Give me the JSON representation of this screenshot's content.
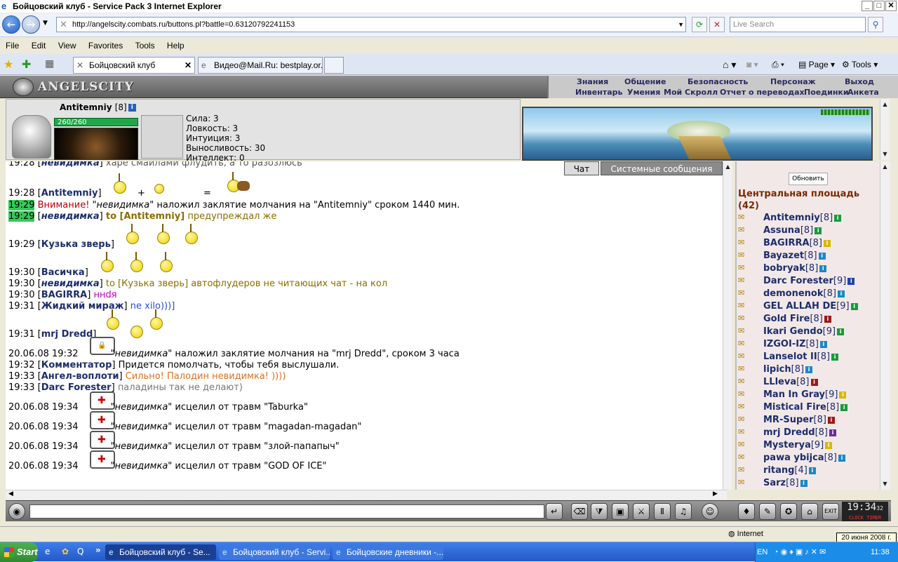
{
  "window": {
    "title": "Бойцовский клуб - Service Pack 3 Internet Explorer"
  },
  "browser": {
    "url": "http://angelscity.combats.ru/buttons.pl?battle=0.63120792241153",
    "search_placeholder": "Live Search",
    "menu": [
      "File",
      "Edit",
      "View",
      "Favorites",
      "Tools",
      "Help"
    ],
    "tabs": [
      "Бойцовский клуб",
      "Видео@Mail.Ru: bestplay.or..."
    ],
    "cmd_page": "Page",
    "cmd_tools": "Tools"
  },
  "game": {
    "logo": "ANGELSCITY",
    "topmenu_row1": [
      "Знания",
      "Общение",
      "Безопасность",
      "Персонаж",
      "Выход"
    ],
    "topmenu_row2": [
      "Инвентарь",
      "Умения",
      "Мой Скролл",
      "Отчет о переводах",
      "Поединки",
      "Анкета"
    ],
    "character": {
      "name": "Antitemniy",
      "level": "[8]",
      "hp": "260/260",
      "stats": [
        "Сила: 3",
        "Ловкость: 3",
        "Интуиция: 3",
        "Выносливость: 30",
        "Интеллект: 0"
      ]
    },
    "chat_tabs": [
      "Чат",
      "Системные сообщения"
    ],
    "chat": [
      {
        "time": "19:28",
        "nick": "невидимка",
        "msg": "харе смайлами флудить, а то разозлюсь"
      },
      {
        "time": "19:28",
        "nick": "Antitemniy",
        "plus": "+",
        "eq": "="
      },
      {
        "time": "19:29",
        "warn": "Внимание!",
        "nick": "невидимка",
        "msg": "наложил заклятие молчания на \"Antitemniy\" сроком 1440 мин."
      },
      {
        "time": "19:29",
        "nick": "невидимка",
        "to": "to [Antitemniy]",
        "msg": "предупреждал же"
      },
      {
        "time": "19:29",
        "nick": "Кузька зверь"
      },
      {
        "time": "19:30",
        "nick": "Васичка"
      },
      {
        "time": "19:30",
        "nick": "невидимка",
        "msg": "to [Кузька зверь] автофлудеров не читающих чат - на кол"
      },
      {
        "time": "19:30",
        "nick": "BAGIRRA",
        "msg": "ннdя"
      },
      {
        "time": "19:31",
        "nick": "Жидкий мираж",
        "msg": "ne xilo)))]"
      },
      {
        "time": "19:31",
        "nick": "mrj Dredd"
      },
      {
        "time": "20.06.08 19:32",
        "nick": "невидимка",
        "msg": "наложил заклятие молчания на \"mrj Dredd\", сроком 3 часа"
      },
      {
        "time": "19:32",
        "nick": "Комментатор",
        "msg": "Придется помолчать, чтобы тебя выслушали."
      },
      {
        "time": "19:33",
        "nick": "Ангел-воплоти",
        "msg": "Сильно! Палодин невидимка! ))))"
      },
      {
        "time": "19:33",
        "nick": "Darc Forester",
        "msg": "паладины так не делают)"
      },
      {
        "time": "20.06.08 19:34",
        "nick": "невидимка",
        "msg": "исцелил от травм \"Taburka\""
      },
      {
        "time": "20.06.08 19:34",
        "nick": "невидимка",
        "msg": "исцелил от травм \"magadan-magadan\""
      },
      {
        "time": "20.06.08 19:34",
        "nick": "невидимка",
        "msg": "исцелил от травм \"злой-папапыч\""
      },
      {
        "time": "20.06.08 19:34",
        "nick": "невидимка",
        "msg": "исцелил от травм \"GOD OF ICE\""
      }
    ],
    "room": {
      "refresh": "Обновить",
      "name": "Центральная площадь",
      "count": "(42)",
      "users": [
        {
          "name": "Antitemniy",
          "lvl": "[8]",
          "badge": "green"
        },
        {
          "name": "Assuna",
          "lvl": "[8]",
          "badge": "green"
        },
        {
          "name": "BAGIRRA",
          "lvl": "[8]",
          "badge": "yellow"
        },
        {
          "name": "Bayazet",
          "lvl": "[8]",
          "badge": "blue"
        },
        {
          "name": "bobryak",
          "lvl": "[8]",
          "badge": "blue"
        },
        {
          "name": "Darc Forester",
          "lvl": "[9]",
          "badge": "darkblue"
        },
        {
          "name": "demonenok",
          "lvl": "[8]",
          "badge": "blue"
        },
        {
          "name": "GEL ALLAH DE",
          "lvl": "[9]",
          "badge": "green"
        },
        {
          "name": "Gold Fire",
          "lvl": "[8]",
          "badge": "red"
        },
        {
          "name": "Ikari Gendo",
          "lvl": "[9]",
          "badge": "green"
        },
        {
          "name": "IZGOI-IZ",
          "lvl": "[8]",
          "badge": "blue"
        },
        {
          "name": "Lanselot II",
          "lvl": "[8]",
          "badge": "green"
        },
        {
          "name": "lipich",
          "lvl": "[8]",
          "badge": "blue"
        },
        {
          "name": "LLleva",
          "lvl": "[8]",
          "badge": "red"
        },
        {
          "name": "Man In Gray",
          "lvl": "[9]",
          "badge": "yellow"
        },
        {
          "name": "Mistical Fire",
          "lvl": "[8]",
          "badge": "green"
        },
        {
          "name": "MR-Super",
          "lvl": "[8]",
          "badge": "red"
        },
        {
          "name": "mrj Dredd",
          "lvl": "[8]",
          "badge": "purple"
        },
        {
          "name": "Mysterya",
          "lvl": "[9]",
          "badge": "yellow"
        },
        {
          "name": "pawa ybijca",
          "lvl": "[8]",
          "badge": "blue"
        },
        {
          "name": "ritang",
          "lvl": "[4]",
          "badge": "blue"
        },
        {
          "name": "Sarz",
          "lvl": "[8]",
          "badge": "blue"
        }
      ]
    },
    "clock": {
      "time": "19:34",
      "sec": "32",
      "labels": "CLOCK TIMER"
    }
  },
  "statusbar": {
    "zone": "Internet",
    "tooltip": "20 июня 2008 г."
  },
  "taskbar": {
    "start": "Start",
    "items": [
      "Бойцовский клуб - Se...",
      "Бойцовский клуб - Servi...",
      "Бойцовские дневники -..."
    ],
    "lang": "EN",
    "time": "11:38"
  }
}
